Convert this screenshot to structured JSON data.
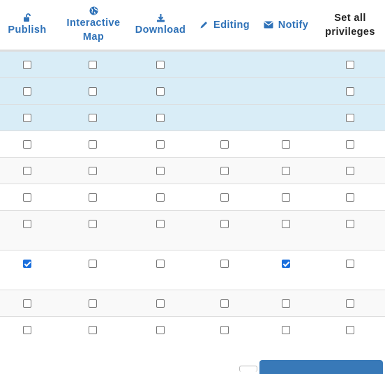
{
  "headers": {
    "publish": "Publish",
    "interactive_map_line1": "Interactive",
    "interactive_map_line2": "Map",
    "download": "Download",
    "editing": "Editing",
    "notify": "Notify",
    "set_all_line1": "Set all",
    "set_all_line2": "privileges"
  },
  "icons": {
    "publish": "unlock-icon",
    "interactive_map": "globe-icon",
    "download": "download-icon",
    "editing": "pencil-icon",
    "notify": "envelope-icon"
  },
  "columns": [
    "publish",
    "interactive_map",
    "download",
    "editing",
    "notify",
    "set_all"
  ],
  "rows": [
    {
      "highlight": true,
      "cells": [
        false,
        false,
        false,
        null,
        null,
        false
      ]
    },
    {
      "highlight": true,
      "cells": [
        false,
        false,
        false,
        null,
        null,
        false
      ]
    },
    {
      "highlight": true,
      "cells": [
        false,
        false,
        false,
        null,
        null,
        false
      ]
    },
    {
      "highlight": false,
      "cells": [
        false,
        false,
        false,
        false,
        false,
        false
      ]
    },
    {
      "highlight": false,
      "cells": [
        false,
        false,
        false,
        false,
        false,
        false
      ]
    },
    {
      "highlight": false,
      "cells": [
        false,
        false,
        false,
        false,
        false,
        false
      ]
    },
    {
      "highlight": false,
      "cells": [
        false,
        false,
        false,
        false,
        false,
        false
      ]
    },
    {
      "highlight": false,
      "cells": [
        true,
        false,
        false,
        false,
        true,
        false
      ]
    },
    {
      "highlight": false,
      "cells": [
        false,
        false,
        false,
        false,
        false,
        false
      ]
    },
    {
      "highlight": false,
      "cells": [
        false,
        false,
        false,
        false,
        false,
        false
      ]
    }
  ],
  "colors": {
    "accent": "#2f72b8",
    "row_highlight": "#d9edf7",
    "row_alt": "#f9f9f9",
    "checked": "#1a6fdd",
    "border": "#dddddd"
  }
}
